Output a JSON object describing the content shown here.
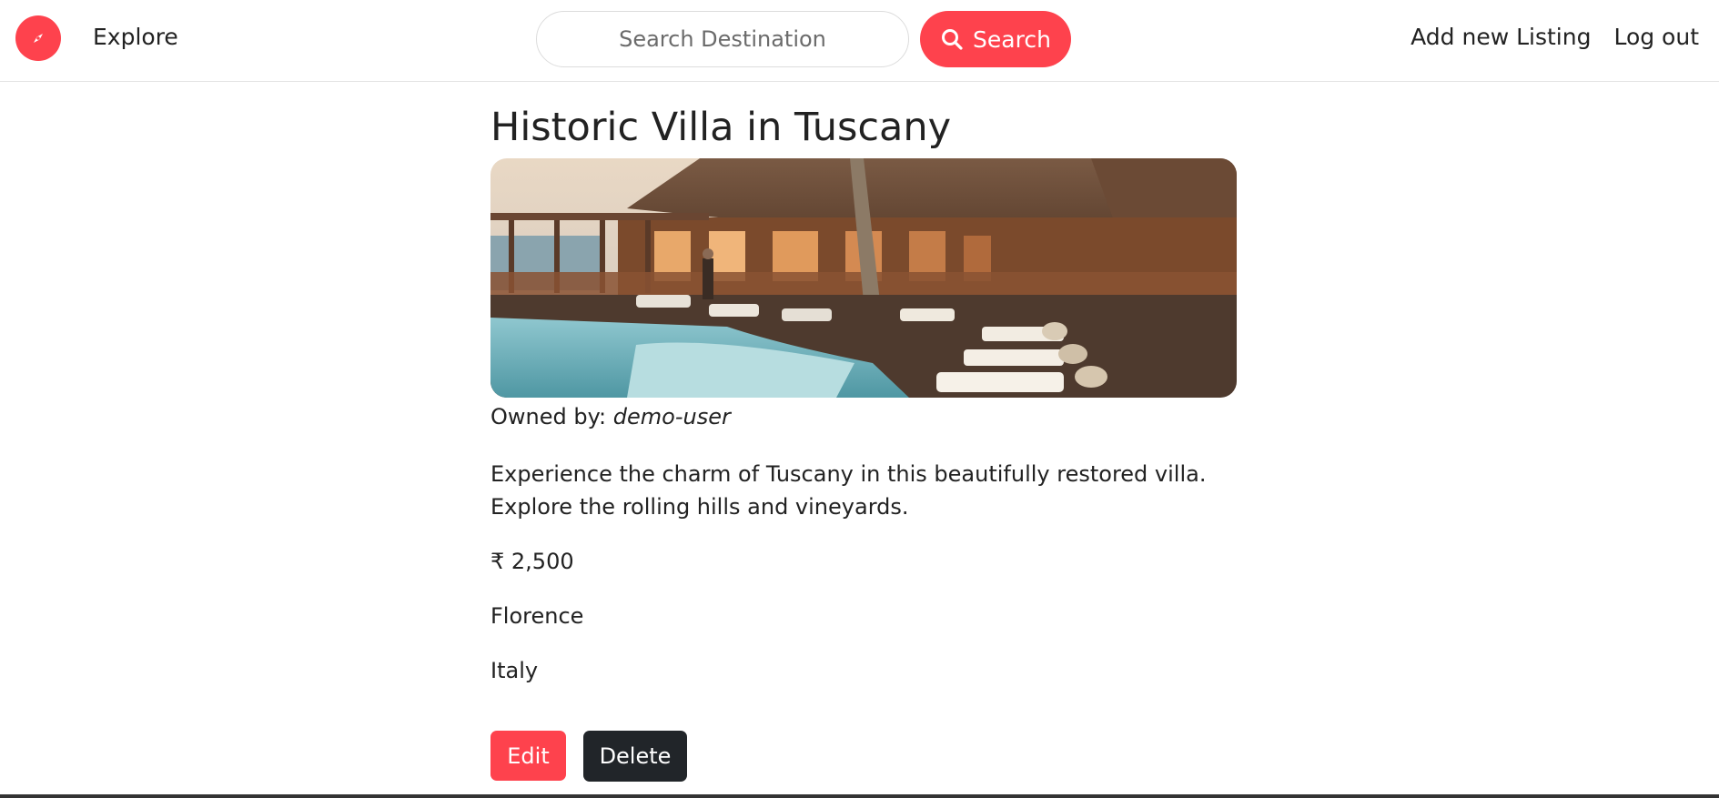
{
  "navbar": {
    "logo_icon": "compass-icon",
    "explore_label": "Explore",
    "search_placeholder": "Search Destination",
    "search_value": "",
    "search_button_label": "Search",
    "search_icon": "search-icon",
    "add_listing_label": "Add new Listing",
    "logout_label": "Log out"
  },
  "listing": {
    "title": "Historic Villa in Tuscany",
    "owner_prefix": "Owned by: ",
    "owner_name": "demo-user",
    "description": "Experience the charm of Tuscany in this beautifully restored villa. Explore the rolling hills and vineyards.",
    "price": "₹ 2,500",
    "location": "Florence",
    "country": "Italy"
  },
  "actions": {
    "edit_label": "Edit",
    "delete_label": "Delete"
  },
  "colors": {
    "brand": "#fe424d",
    "dark_button": "#212529"
  }
}
